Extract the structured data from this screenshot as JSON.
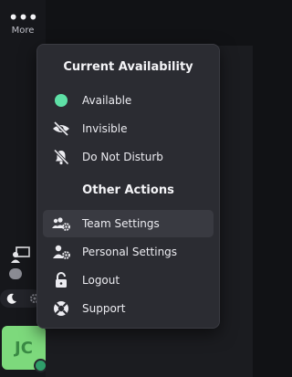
{
  "sidebar": {
    "more_icon": "ellipsis-icon",
    "more_label": "More",
    "avatar_initials": "JC"
  },
  "menu": {
    "availability_title": "Current Availability",
    "availability_options": [
      {
        "label": "Available",
        "icon": "green-dot-icon"
      },
      {
        "label": "Invisible",
        "icon": "eye-slash-icon"
      },
      {
        "label": "Do Not Disturb",
        "icon": "bell-slash-icon"
      }
    ],
    "other_title": "Other Actions",
    "other_actions": [
      {
        "label": "Team Settings",
        "icon": "team-gear-icon"
      },
      {
        "label": "Personal Settings",
        "icon": "user-gear-icon"
      },
      {
        "label": "Logout",
        "icon": "unlock-icon"
      },
      {
        "label": "Support",
        "icon": "lifebuoy-icon"
      }
    ]
  },
  "colors": {
    "available": "#5ee0a6",
    "avatar_bg": "#7dd97c",
    "menu_bg": "#2b2c32"
  }
}
